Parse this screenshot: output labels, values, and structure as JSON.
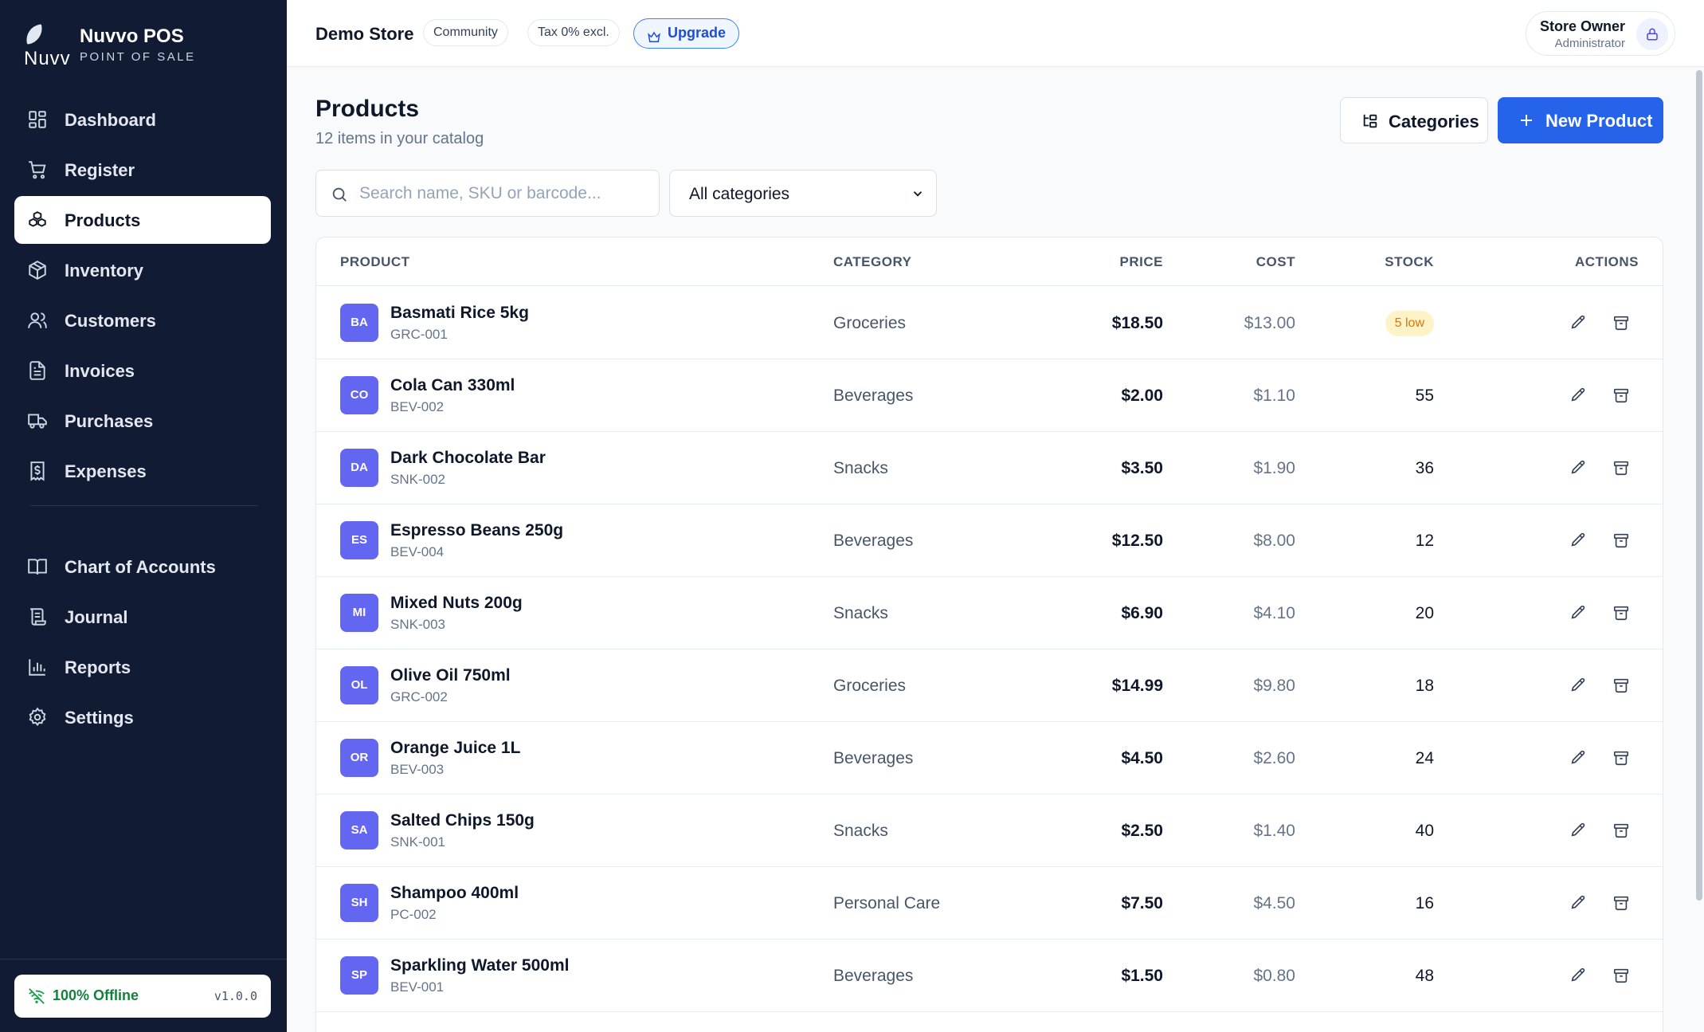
{
  "brand": {
    "name": "Nuvvo POS",
    "subtitle": "POINT OF SALE",
    "logo_text": "Nuvv"
  },
  "sidebar": {
    "items": [
      {
        "label": "Dashboard",
        "icon": "layout-grid-icon"
      },
      {
        "label": "Register",
        "icon": "cart-icon"
      },
      {
        "label": "Products",
        "icon": "boxes-icon",
        "active": true
      },
      {
        "label": "Inventory",
        "icon": "package-icon"
      },
      {
        "label": "Customers",
        "icon": "users-icon"
      },
      {
        "label": "Invoices",
        "icon": "file-text-icon"
      },
      {
        "label": "Purchases",
        "icon": "truck-icon"
      },
      {
        "label": "Expenses",
        "icon": "receipt-dollar-icon"
      },
      {
        "label": "Chart of Accounts",
        "icon": "book-icon"
      },
      {
        "label": "Journal",
        "icon": "scroll-icon"
      },
      {
        "label": "Reports",
        "icon": "bar-chart-icon"
      },
      {
        "label": "Settings",
        "icon": "gear-icon"
      }
    ],
    "status": {
      "label": "100% Offline",
      "version": "v1.0.0"
    }
  },
  "topbar": {
    "store_name": "Demo Store",
    "plan_badge": "Community",
    "tax_badge": "Tax 0% excl.",
    "upgrade_label": "Upgrade",
    "user_name": "Store Owner",
    "user_role": "Administrator"
  },
  "page": {
    "title": "Products",
    "subtitle": "12 items in your catalog",
    "categories_button": "Categories",
    "new_button": "New Product",
    "search_placeholder": "Search name, SKU or barcode...",
    "category_filter": "All categories"
  },
  "table": {
    "headers": {
      "product": "PRODUCT",
      "category": "CATEGORY",
      "price": "PRICE",
      "cost": "COST",
      "stock": "STOCK",
      "actions": "ACTIONS"
    },
    "rows": [
      {
        "initials": "BA",
        "name": "Basmati Rice 5kg",
        "sku": "GRC-001",
        "category": "Groceries",
        "price": "$18.50",
        "cost": "$13.00",
        "stock": "5 low",
        "low": true
      },
      {
        "initials": "CO",
        "name": "Cola Can 330ml",
        "sku": "BEV-002",
        "category": "Beverages",
        "price": "$2.00",
        "cost": "$1.10",
        "stock": "55",
        "low": false
      },
      {
        "initials": "DA",
        "name": "Dark Chocolate Bar",
        "sku": "SNK-002",
        "category": "Snacks",
        "price": "$3.50",
        "cost": "$1.90",
        "stock": "36",
        "low": false
      },
      {
        "initials": "ES",
        "name": "Espresso Beans 250g",
        "sku": "BEV-004",
        "category": "Beverages",
        "price": "$12.50",
        "cost": "$8.00",
        "stock": "12",
        "low": false
      },
      {
        "initials": "MI",
        "name": "Mixed Nuts 200g",
        "sku": "SNK-003",
        "category": "Snacks",
        "price": "$6.90",
        "cost": "$4.10",
        "stock": "20",
        "low": false
      },
      {
        "initials": "OL",
        "name": "Olive Oil 750ml",
        "sku": "GRC-002",
        "category": "Groceries",
        "price": "$14.99",
        "cost": "$9.80",
        "stock": "18",
        "low": false
      },
      {
        "initials": "OR",
        "name": "Orange Juice 1L",
        "sku": "BEV-003",
        "category": "Beverages",
        "price": "$4.50",
        "cost": "$2.60",
        "stock": "24",
        "low": false
      },
      {
        "initials": "SA",
        "name": "Salted Chips 150g",
        "sku": "SNK-001",
        "category": "Snacks",
        "price": "$2.50",
        "cost": "$1.40",
        "stock": "40",
        "low": false
      },
      {
        "initials": "SH",
        "name": "Shampoo 400ml",
        "sku": "PC-002",
        "category": "Personal Care",
        "price": "$7.50",
        "cost": "$4.50",
        "stock": "16",
        "low": false
      },
      {
        "initials": "SP",
        "name": "Sparkling Water 500ml",
        "sku": "BEV-001",
        "category": "Beverages",
        "price": "$1.50",
        "cost": "$0.80",
        "stock": "48",
        "low": false
      }
    ]
  },
  "colors": {
    "sidebar_bg": "#111b33",
    "primary": "#2563eb",
    "avatar": "#6366f1",
    "low_stock_bg": "#fef3c7",
    "low_stock_text": "#d97706",
    "offline_green": "#15803d"
  }
}
